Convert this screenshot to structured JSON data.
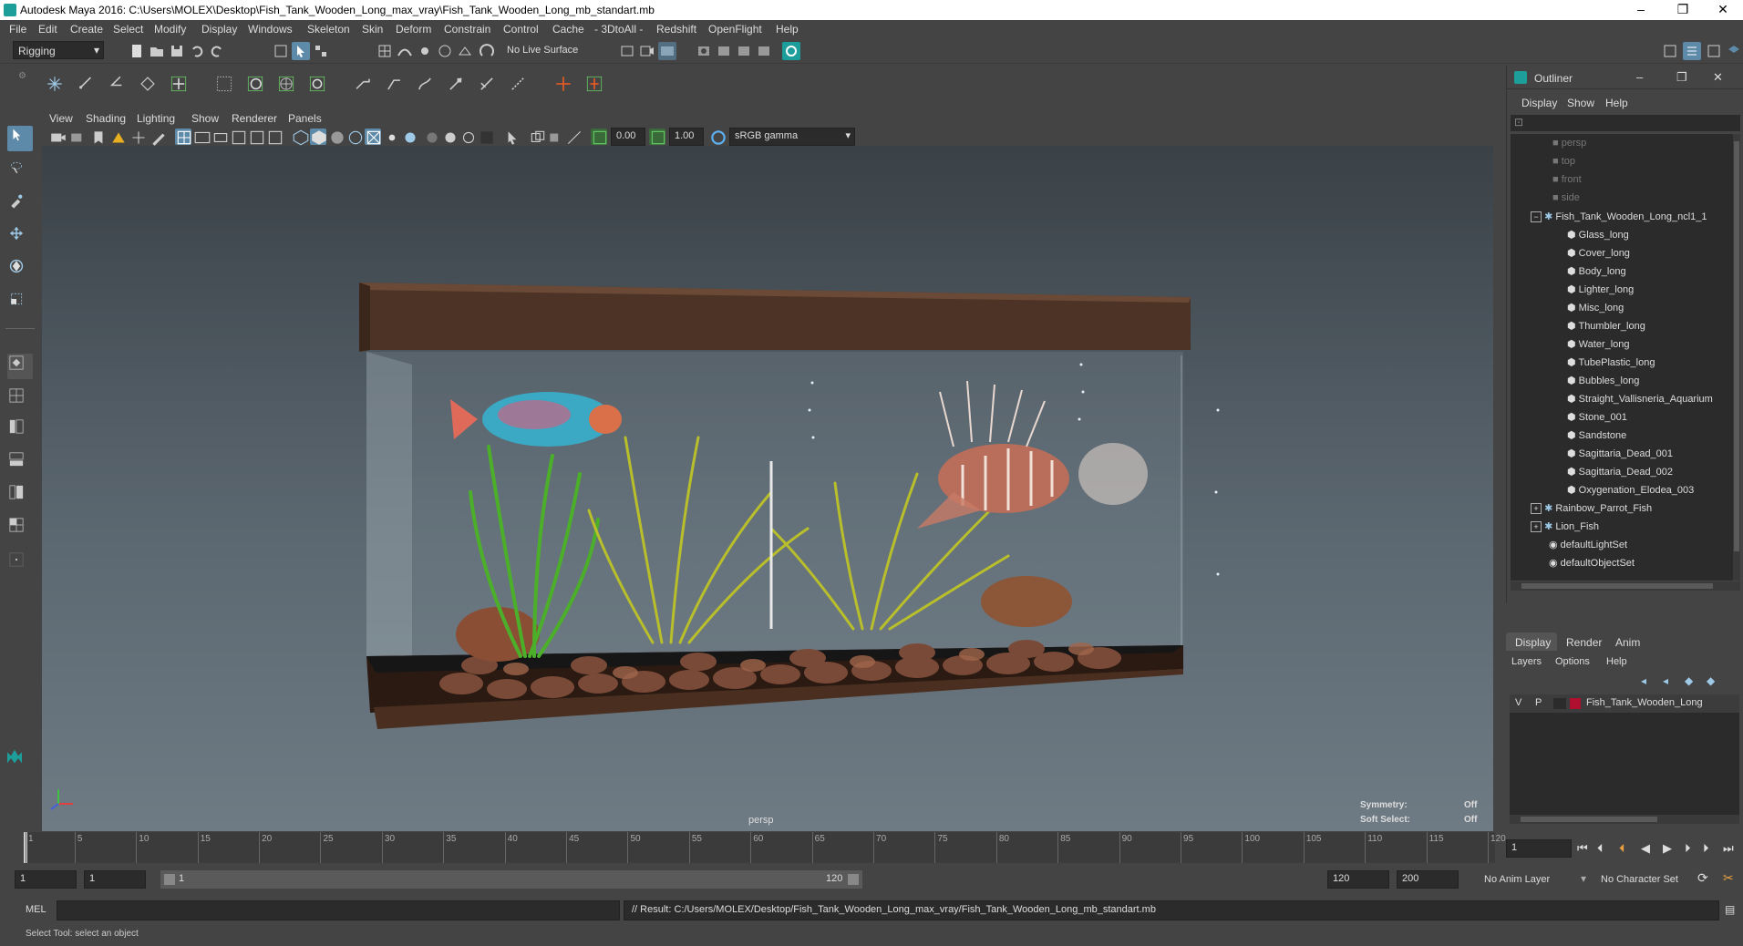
{
  "window": {
    "title": "Autodesk Maya 2016: C:\\Users\\MOLEX\\Desktop\\Fish_Tank_Wooden_Long_max_vray\\Fish_Tank_Wooden_Long_mb_standart.mb",
    "minimize": "–",
    "restore": "❐",
    "close": "✕"
  },
  "menus": [
    "File",
    "Edit",
    "Create",
    "Select",
    "Modify",
    "Display",
    "Windows",
    "Skeleton",
    "Skin",
    "Deform",
    "Constrain",
    "Control",
    "Cache",
    "- 3DtoAll -",
    "Redshift",
    "OpenFlight",
    "Help"
  ],
  "toolbar": {
    "mode": "Rigging",
    "live_surface": "No Live Surface"
  },
  "viewport": {
    "menus": [
      "View",
      "Shading",
      "Lighting",
      "Show",
      "Renderer",
      "Panels"
    ],
    "near": "0.00",
    "far": "1.00",
    "color_space": "sRGB gamma",
    "camera_label": "persp",
    "symmetry_label": "Symmetry:",
    "symmetry_value": "Off",
    "soft_select_label": "Soft Select:",
    "soft_select_value": "Off"
  },
  "outliner": {
    "title": "Outliner",
    "menus": [
      "Display",
      "Show",
      "Help"
    ],
    "items": [
      {
        "label": "persp",
        "type": "camera",
        "dim": true,
        "indent": 0
      },
      {
        "label": "top",
        "type": "camera",
        "dim": true,
        "indent": 0
      },
      {
        "label": "front",
        "type": "camera",
        "dim": true,
        "indent": 0
      },
      {
        "label": "side",
        "type": "camera",
        "dim": true,
        "indent": 0
      },
      {
        "label": "Fish_Tank_Wooden_Long_ncl1_1",
        "type": "group",
        "expanded": true,
        "indent": 0
      },
      {
        "label": "Glass_long",
        "type": "mesh",
        "indent": 1
      },
      {
        "label": "Cover_long",
        "type": "mesh",
        "indent": 1
      },
      {
        "label": "Body_long",
        "type": "mesh",
        "indent": 1
      },
      {
        "label": "Lighter_long",
        "type": "mesh",
        "indent": 1
      },
      {
        "label": "Misc_long",
        "type": "mesh",
        "indent": 1
      },
      {
        "label": "Thumbler_long",
        "type": "mesh",
        "indent": 1
      },
      {
        "label": "Water_long",
        "type": "mesh",
        "indent": 1
      },
      {
        "label": "TubePlastic_long",
        "type": "mesh",
        "indent": 1
      },
      {
        "label": "Bubbles_long",
        "type": "mesh",
        "indent": 1
      },
      {
        "label": "Straight_Vallisneria_Aquarium",
        "type": "mesh",
        "indent": 1
      },
      {
        "label": "Stone_001",
        "type": "mesh",
        "indent": 1
      },
      {
        "label": "Sandstone",
        "type": "mesh",
        "indent": 1
      },
      {
        "label": "Sagittaria_Dead_001",
        "type": "mesh",
        "indent": 1
      },
      {
        "label": "Sagittaria_Dead_002",
        "type": "mesh",
        "indent": 1
      },
      {
        "label": "Oxygenation_Elodea_003",
        "type": "mesh",
        "indent": 1
      },
      {
        "label": "Rainbow_Parrot_Fish",
        "type": "group",
        "expanded": false,
        "indent": 0
      },
      {
        "label": "Lion_Fish",
        "type": "group",
        "expanded": false,
        "indent": 0
      },
      {
        "label": "defaultLightSet",
        "type": "set",
        "indent": 0
      },
      {
        "label": "defaultObjectSet",
        "type": "set",
        "indent": 0
      }
    ]
  },
  "layers": {
    "tabs": [
      "Display",
      "Render",
      "Anim"
    ],
    "menus": [
      "Layers",
      "Options",
      "Help"
    ],
    "layer": {
      "v": "V",
      "p": "P",
      "name": "Fish_Tank_Wooden_Long",
      "color": "#b01030"
    }
  },
  "timeline": {
    "ticks": [
      "1",
      "5",
      "10",
      "15",
      "20",
      "25",
      "30",
      "35",
      "40",
      "45",
      "50",
      "55",
      "60",
      "65",
      "70",
      "75",
      "80",
      "85",
      "90",
      "95",
      "100",
      "105",
      "110",
      "115",
      "120"
    ],
    "current_frame": "1"
  },
  "range": {
    "start": "1",
    "start2": "1",
    "slider_start": "1",
    "slider_end": "120",
    "end": "120",
    "end2": "200",
    "anim_layer": "No Anim Layer",
    "char_set": "No Character Set"
  },
  "command": {
    "lang": "MEL",
    "result": "// Result: C:/Users/MOLEX/Desktop/Fish_Tank_Wooden_Long_max_vray/Fish_Tank_Wooden_Long_mb_standart.mb"
  },
  "help": {
    "text": "Select Tool: select an object"
  },
  "colors": {
    "accent": "#5d8aa8",
    "bg": "#444444",
    "field": "#2b2b2b"
  }
}
